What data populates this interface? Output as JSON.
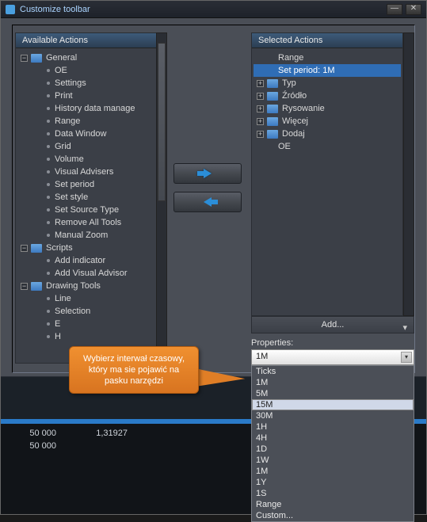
{
  "window": {
    "title": "Customize toolbar"
  },
  "available": {
    "header": "Available Actions",
    "groups": {
      "general": {
        "label": "General",
        "items": [
          "OE",
          "Settings",
          "Print",
          "History data manage",
          "Range",
          "Data Window",
          "Grid",
          "Volume",
          "Visual Advisers",
          "Set period",
          "Set style",
          "Set Source Type",
          "Remove All Tools",
          "Manual Zoom"
        ]
      },
      "scripts": {
        "label": "Scripts",
        "items": [
          "Add indicator",
          "Add Visual Advisor"
        ]
      },
      "drawing": {
        "label": "Drawing Tools",
        "items": [
          "Line",
          "Selection",
          "E",
          "H"
        ]
      }
    }
  },
  "selected": {
    "header": "Selected Actions",
    "items": {
      "range": "Range",
      "setperiod": "Set period: 1M",
      "typ": "Typ",
      "zrodlo": "Źródło",
      "rysowanie": "Rysowanie",
      "wiecej": "Więcej",
      "dodaj": "Dodaj",
      "oe": "OE"
    },
    "add": "Add..."
  },
  "properties": {
    "label": "Properties:",
    "value": "1M"
  },
  "dropdown": [
    "Ticks",
    "1M",
    "5M",
    "15M",
    "30M",
    "1H",
    "4H",
    "1D",
    "1W",
    "1M",
    "1Y",
    "1S",
    "Range",
    "Custom..."
  ],
  "callout": {
    "text": "Wybierz interwał czasowy, który ma sie pojawić na pasku narzędzi"
  },
  "bgrows": {
    "r1a": "50 000",
    "r1b": "1,31927",
    "r2a": "50 000"
  }
}
